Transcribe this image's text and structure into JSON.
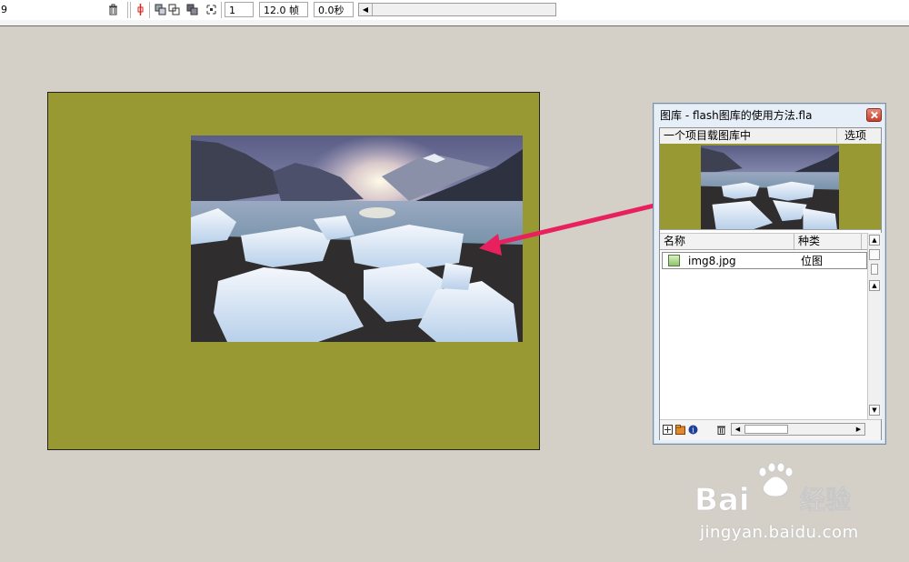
{
  "timeline": {
    "layer_glyph": "9",
    "frame_number": "1",
    "frame_rate": "12.0 帧",
    "elapsed_time": "0.0秒",
    "icons": [
      "trash-icon",
      "center-frame-icon",
      "onion-skin-icon",
      "onion-skin-outlines-icon",
      "edit-multiple-frames-icon",
      "modify-onion-markers-icon"
    ]
  },
  "library": {
    "title": "图库 - flash图库的使用方法.fla",
    "item_count": "一个项目载图库中",
    "options_label": "选项",
    "columns": {
      "name": "名称",
      "kind": "种类"
    },
    "items": [
      {
        "name": "img8.jpg",
        "kind": "位图",
        "icon": "bitmap-icon"
      }
    ],
    "footer_icons": [
      "new-symbol-icon",
      "new-folder-icon",
      "properties-icon",
      "delete-icon"
    ]
  },
  "stage": {
    "background_color": "#999933",
    "image": "img8.jpg"
  },
  "annotation": {
    "arrow_color": "#e8205e"
  },
  "watermark": {
    "logo_text": "Bai",
    "logo_suffix": "经验",
    "url": "jingyan.baidu.com"
  }
}
